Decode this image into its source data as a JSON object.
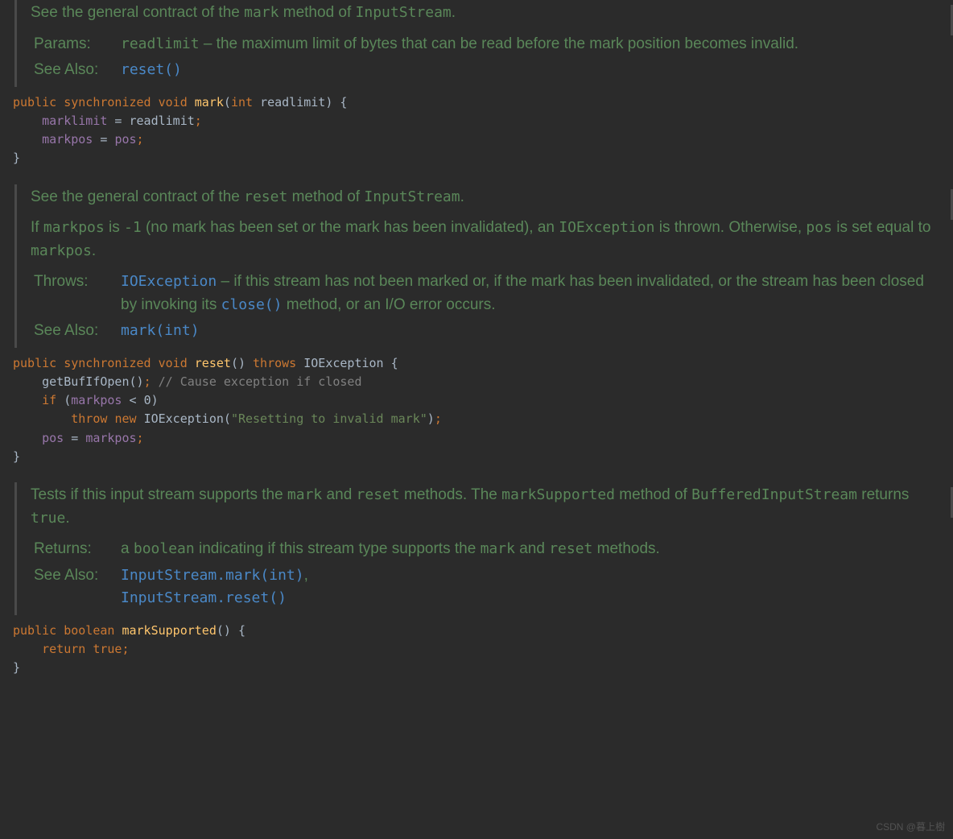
{
  "mark": {
    "summary_pre": "See the general contract of the ",
    "summary_code": "mark",
    "summary_mid": " method of ",
    "summary_code2": "InputStream",
    "summary_post": ".",
    "params_label": "Params:",
    "params_name": "readlimit",
    "params_desc": " – the maximum limit of bytes that can be read before the mark position becomes invalid.",
    "seealso_label": "See Also:",
    "seealso_link": "reset()",
    "code": {
      "kw_public": "public ",
      "kw_sync": "synchronized ",
      "kw_void": "void ",
      "fn": "mark",
      "lp": "(",
      "kw_int": "int ",
      "arg": "readlimit",
      "rp": ") {",
      "l1_fld": "marklimit",
      "l1_rest": " = readlimit",
      "l1_semi": ";",
      "l2_fld": "markpos",
      "l2_rest": " = ",
      "l2_fld2": "pos",
      "l2_semi": ";",
      "close": "}"
    }
  },
  "reset": {
    "summary_pre": "See the general contract of the ",
    "summary_code": "reset",
    "summary_mid": " method of ",
    "summary_code2": "InputStream",
    "summary_post": ".",
    "para2_a": "If ",
    "para2_code1": "markpos",
    "para2_b": " is ",
    "para2_code2": "-1",
    "para2_c": " (no mark has been set or the mark has been invalidated), an ",
    "para2_code3": "IOException",
    "para2_d": " is thrown. Otherwise, ",
    "para2_code4": "pos",
    "para2_e": " is set equal to ",
    "para2_code5": "markpos",
    "para2_f": ".",
    "throws_label": "Throws:",
    "throws_link": "IOException",
    "throws_desc_a": " – if this stream has not been marked or, if the mark has been invalidated, or the stream has been closed by invoking its ",
    "throws_link2": "close()",
    "throws_desc_b": " method, or an I/O error occurs.",
    "seealso_label": "See Also:",
    "seealso_link": "mark(int)",
    "code": {
      "kw_public": "public ",
      "kw_sync": "synchronized ",
      "kw_void": "void ",
      "fn": "reset",
      "sig_rest": "() ",
      "kw_throws": "throws ",
      "exc": "IOException",
      "brace": " {",
      "l1_call": "getBufIfOpen()",
      "l1_semi": ";",
      "l1_cmt_pre": " // ",
      "l1_cmt": "Cause exception if closed",
      "l2_if": "if ",
      "l2_lp": "(",
      "l2_fld": "markpos",
      "l2_rest": " < ",
      "l2_num": "0",
      "l2_rp": ")",
      "l3_throw": "throw ",
      "l3_new": "new ",
      "l3_exc": "IOException",
      "l3_lp": "(",
      "l3_str": "\"Resetting to invalid mark\"",
      "l3_rp": ")",
      "l3_semi": ";",
      "l4_fld": "pos",
      "l4_rest": " = ",
      "l4_fld2": "markpos",
      "l4_semi": ";",
      "close": "}"
    }
  },
  "markSupported": {
    "summary_a": "Tests if this input stream supports the ",
    "summary_code1": "mark",
    "summary_b": " and ",
    "summary_code2": "reset",
    "summary_c": " methods. The ",
    "summary_code3": "markSupported",
    "summary_d": " method of ",
    "summary_code4": "BufferedInputStream",
    "summary_e": " returns ",
    "summary_code5": "true",
    "summary_f": ".",
    "returns_label": "Returns:",
    "returns_a": "a ",
    "returns_code1": "boolean",
    "returns_b": " indicating if this stream type supports the ",
    "returns_code2": "mark",
    "returns_c": " and ",
    "returns_code3": "reset",
    "returns_d": " methods.",
    "seealso_label": "See Also:",
    "seealso_link1": "InputStream.mark(int)",
    "seealso_sep": ", ",
    "seealso_link2": "InputStream.reset()",
    "code": {
      "kw_public": "public ",
      "kw_boolean": "boolean ",
      "fn": "markSupported",
      "sig_rest": "() {",
      "l1_return": "return ",
      "l1_true": "true",
      "l1_semi": ";",
      "close": "}"
    }
  },
  "watermark": "CSDN @暮上樹"
}
